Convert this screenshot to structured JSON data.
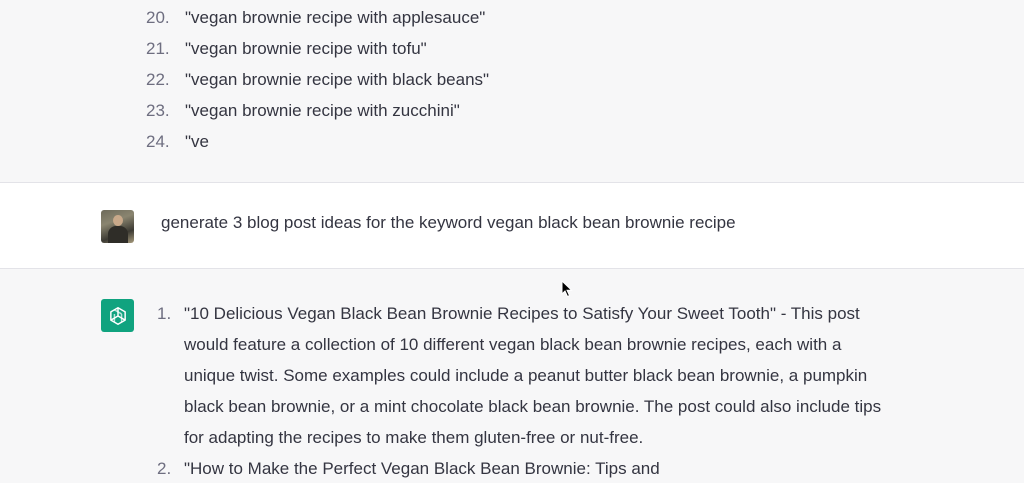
{
  "top_response": {
    "items": [
      {
        "num": "20.",
        "text": "\"vegan brownie recipe with applesauce\""
      },
      {
        "num": "21.",
        "text": "\"vegan brownie recipe with tofu\""
      },
      {
        "num": "22.",
        "text": "\"vegan brownie recipe with black beans\""
      },
      {
        "num": "23.",
        "text": "\"vegan brownie recipe with zucchini\""
      },
      {
        "num": "24.",
        "text": "\"ve"
      }
    ]
  },
  "user_message": {
    "avatar": "user-avatar",
    "text": "generate 3 blog post ideas for the keyword vegan black bean brownie recipe"
  },
  "bottom_response": {
    "logo": "openai-logo-icon",
    "logo_color": "#10a37f",
    "items": [
      {
        "num": "1.",
        "text": "\"10 Delicious Vegan Black Bean Brownie Recipes to Satisfy Your Sweet Tooth\" - This post would feature a collection of 10 different vegan black bean brownie recipes, each with a unique twist. Some examples could include a peanut butter black bean brownie, a pumpkin black bean brownie, or a mint chocolate black bean brownie. The post could also include tips for adapting the recipes to make them gluten-free or nut-free."
      },
      {
        "num": "2.",
        "text": "\"How to Make the Perfect Vegan Black Bean Brownie: Tips and"
      }
    ]
  }
}
